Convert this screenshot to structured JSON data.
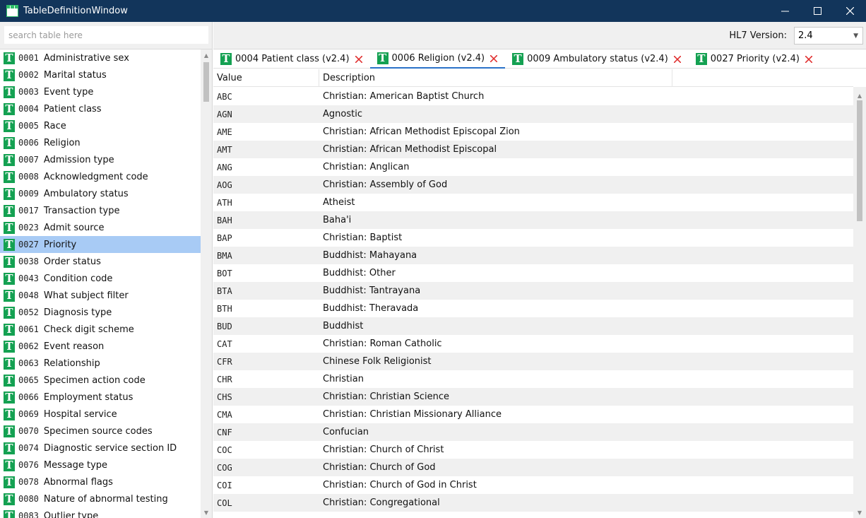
{
  "window": {
    "title": "TableDefinitionWindow",
    "controls": {
      "minimize": "—",
      "maximize": "☐",
      "close": "✕"
    }
  },
  "search": {
    "placeholder": "search table here",
    "value": ""
  },
  "version": {
    "label": "HL7 Version:",
    "selected": "2.4"
  },
  "table_icon_letter": "T",
  "sidebar": {
    "items": [
      {
        "code": "0001",
        "name": "Administrative sex"
      },
      {
        "code": "0002",
        "name": "Marital status"
      },
      {
        "code": "0003",
        "name": "Event type"
      },
      {
        "code": "0004",
        "name": "Patient class"
      },
      {
        "code": "0005",
        "name": "Race"
      },
      {
        "code": "0006",
        "name": "Religion"
      },
      {
        "code": "0007",
        "name": "Admission type"
      },
      {
        "code": "0008",
        "name": "Acknowledgment code"
      },
      {
        "code": "0009",
        "name": "Ambulatory status"
      },
      {
        "code": "0017",
        "name": "Transaction type"
      },
      {
        "code": "0023",
        "name": "Admit source"
      },
      {
        "code": "0027",
        "name": "Priority",
        "selected": true
      },
      {
        "code": "0038",
        "name": "Order status"
      },
      {
        "code": "0043",
        "name": "Condition code"
      },
      {
        "code": "0048",
        "name": "What subject filter"
      },
      {
        "code": "0052",
        "name": "Diagnosis type"
      },
      {
        "code": "0061",
        "name": "Check digit scheme"
      },
      {
        "code": "0062",
        "name": "Event reason"
      },
      {
        "code": "0063",
        "name": "Relationship"
      },
      {
        "code": "0065",
        "name": "Specimen action code"
      },
      {
        "code": "0066",
        "name": "Employment status"
      },
      {
        "code": "0069",
        "name": "Hospital service"
      },
      {
        "code": "0070",
        "name": "Specimen source codes"
      },
      {
        "code": "0074",
        "name": "Diagnostic service section ID"
      },
      {
        "code": "0076",
        "name": "Message type"
      },
      {
        "code": "0078",
        "name": "Abnormal flags"
      },
      {
        "code": "0080",
        "name": "Nature of abnormal testing"
      },
      {
        "code": "0083",
        "name": "Outlier type"
      }
    ]
  },
  "tabs": [
    {
      "label": "0004  Patient class  (v2.4)",
      "active": false
    },
    {
      "label": "0006  Religion  (v2.4)",
      "active": true
    },
    {
      "label": "0009  Ambulatory status  (v2.4)",
      "active": false
    },
    {
      "label": "0027  Priority  (v2.4)",
      "active": false
    }
  ],
  "grid": {
    "columns": {
      "value": "Value",
      "description": "Description"
    },
    "rows": [
      {
        "value": "ABC",
        "description": "Christian: American Baptist Church"
      },
      {
        "value": "AGN",
        "description": "Agnostic"
      },
      {
        "value": "AME",
        "description": "Christian: African Methodist Episcopal Zion"
      },
      {
        "value": "AMT",
        "description": "Christian: African Methodist Episcopal"
      },
      {
        "value": "ANG",
        "description": "Christian: Anglican"
      },
      {
        "value": "AOG",
        "description": "Christian: Assembly of God"
      },
      {
        "value": "ATH",
        "description": "Atheist"
      },
      {
        "value": "BAH",
        "description": "Baha'i"
      },
      {
        "value": "BAP",
        "description": "Christian: Baptist"
      },
      {
        "value": "BMA",
        "description": "Buddhist: Mahayana"
      },
      {
        "value": "BOT",
        "description": "Buddhist: Other"
      },
      {
        "value": "BTA",
        "description": "Buddhist: Tantrayana"
      },
      {
        "value": "BTH",
        "description": "Buddhist: Theravada"
      },
      {
        "value": "BUD",
        "description": "Buddhist"
      },
      {
        "value": "CAT",
        "description": "Christian: Roman Catholic"
      },
      {
        "value": "CFR",
        "description": "Chinese Folk Religionist"
      },
      {
        "value": "CHR",
        "description": "Christian"
      },
      {
        "value": "CHS",
        "description": "Christian: Christian Science"
      },
      {
        "value": "CMA",
        "description": "Christian: Christian Missionary Alliance"
      },
      {
        "value": "CNF",
        "description": "Confucian"
      },
      {
        "value": "COC",
        "description": "Christian: Church of Christ"
      },
      {
        "value": "COG",
        "description": "Christian: Church of God"
      },
      {
        "value": "COI",
        "description": "Christian: Church of God in Christ"
      },
      {
        "value": "COL",
        "description": "Christian: Congregational"
      }
    ]
  },
  "colors": {
    "titlebar": "#12355b",
    "selection": "#a8cbf5",
    "table_icon": "#14a152",
    "close_x": "#e03030",
    "active_tab_underline": "#2a72c8"
  }
}
